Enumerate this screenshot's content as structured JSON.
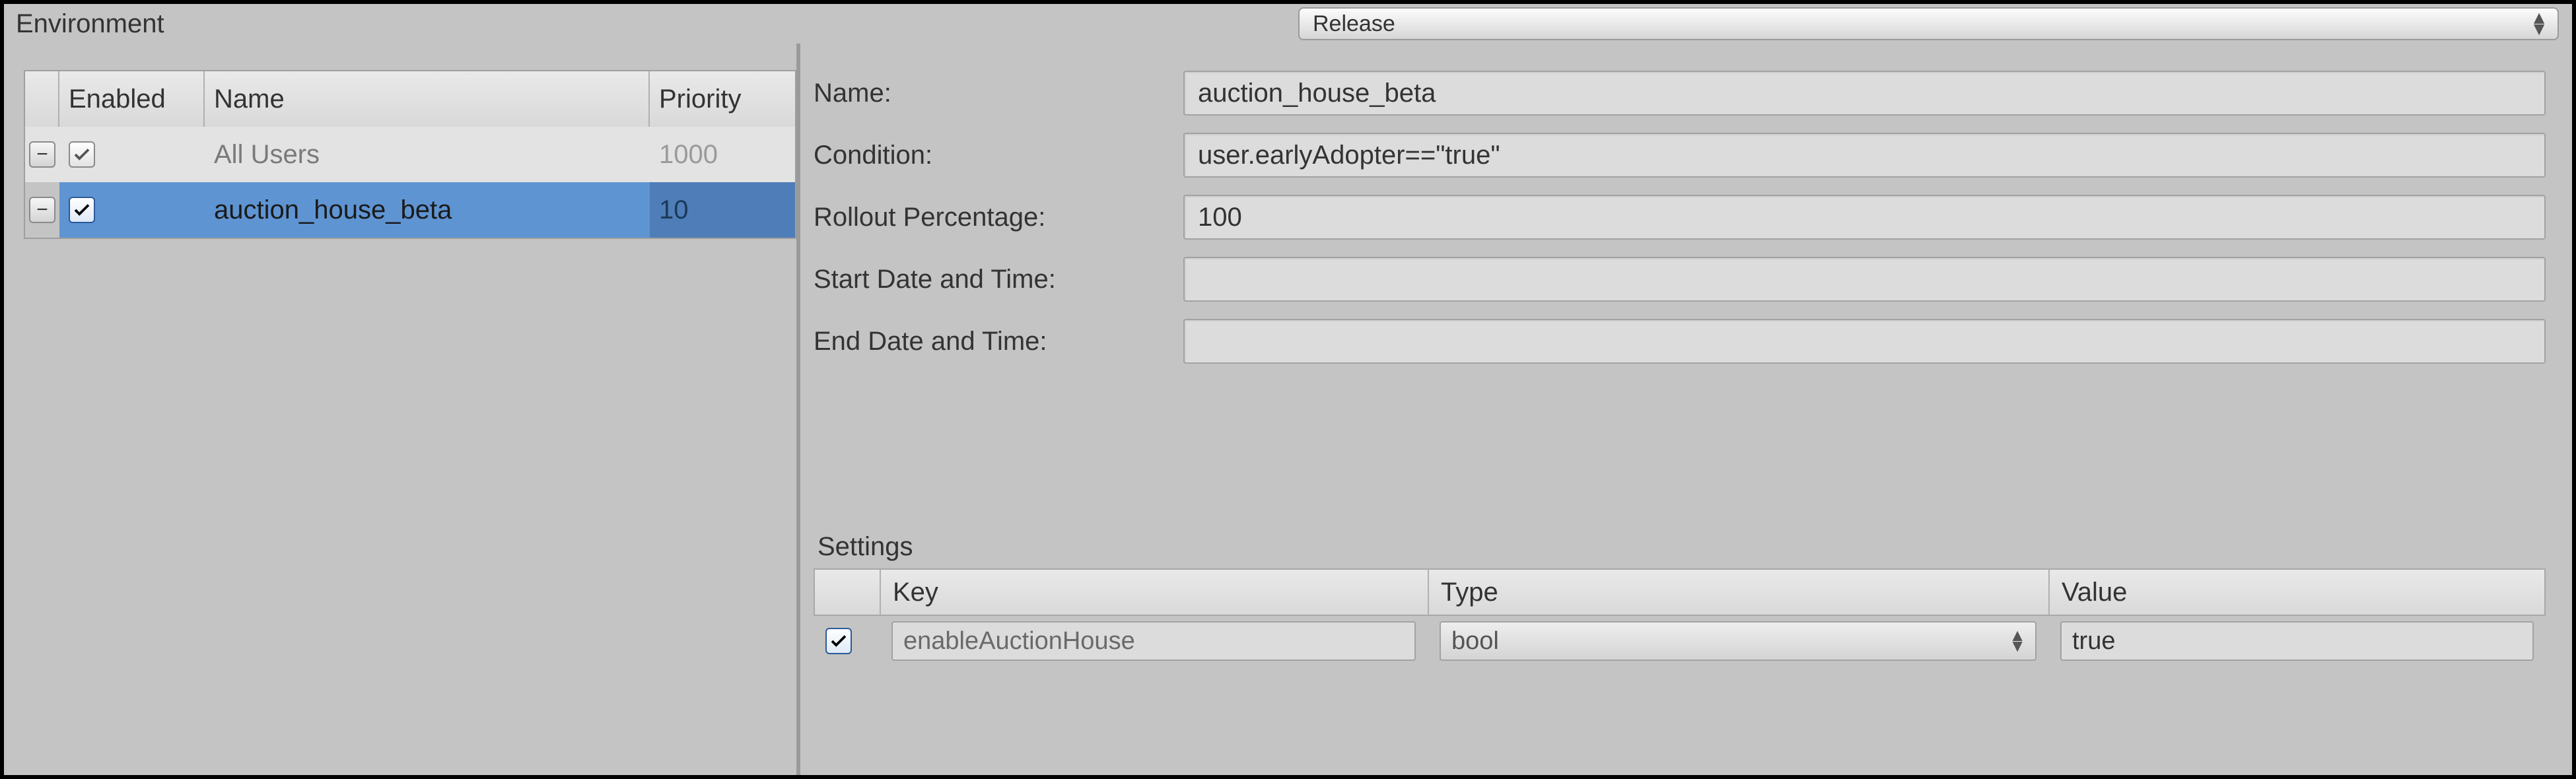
{
  "header": {
    "environment_label": "Environment",
    "release_selected": "Release"
  },
  "segments": {
    "columns": {
      "enabled": "Enabled",
      "name": "Name",
      "priority": "Priority"
    },
    "rows": [
      {
        "enabled": true,
        "name": "All Users",
        "priority": "1000",
        "selected": false
      },
      {
        "enabled": true,
        "name": "auction_house_beta",
        "priority": "10",
        "selected": true
      }
    ]
  },
  "detail": {
    "labels": {
      "name": "Name:",
      "condition": "Condition:",
      "rollout": "Rollout Percentage:",
      "start": "Start Date and Time:",
      "end": "End Date and Time:"
    },
    "values": {
      "name": "auction_house_beta",
      "condition": "user.earlyAdopter==\"true\"",
      "rollout": "100",
      "start": "",
      "end": ""
    }
  },
  "settings": {
    "title": "Settings",
    "columns": {
      "key": "Key",
      "type": "Type",
      "value": "Value"
    },
    "rows": [
      {
        "enabled": true,
        "key": "enableAuctionHouse",
        "type": "bool",
        "value": "true"
      }
    ]
  }
}
